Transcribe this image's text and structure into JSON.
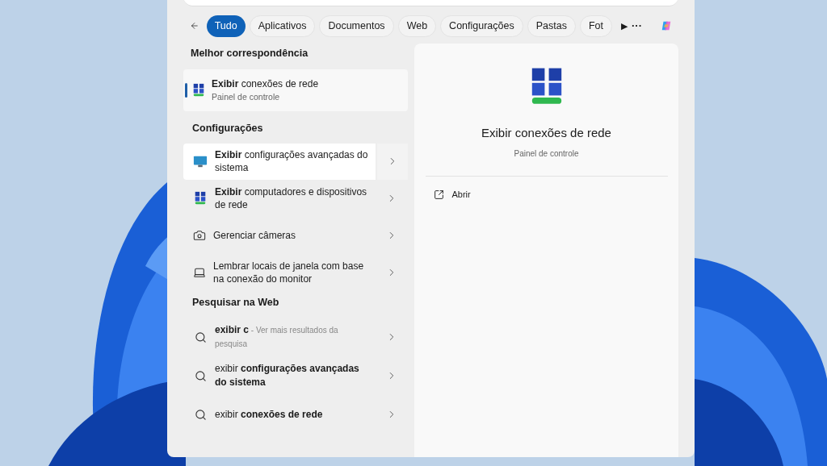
{
  "filters": [
    {
      "label": "Tudo",
      "selected": true
    },
    {
      "label": "Aplicativos",
      "selected": false
    },
    {
      "label": "Documentos",
      "selected": false
    },
    {
      "label": "Web",
      "selected": false
    },
    {
      "label": "Configurações",
      "selected": false
    },
    {
      "label": "Pastas",
      "selected": false
    },
    {
      "label": "Fot",
      "selected": false
    }
  ],
  "more_filters": "▶",
  "overflow": "···",
  "best_match": {
    "heading": "Melhor correspondência",
    "title": "**Exibir** conexões de rede",
    "subtitle": "Painel de controle",
    "selected": true
  },
  "settings": {
    "heading": "Configurações",
    "items": [
      {
        "kind": "monitor",
        "title": "**Exibir** configurações avançadas do sistema",
        "highlighted": true
      },
      {
        "kind": "network",
        "title": "**Exibir** computadores e dispositivos de rede",
        "highlighted": false
      },
      {
        "kind": "camera",
        "title": "Gerenciar câmeras",
        "highlighted": false
      },
      {
        "kind": "laptop",
        "title": "Lembrar locais de janela com base na conexão do monitor",
        "highlighted": false
      }
    ]
  },
  "web_search": {
    "heading": "Pesquisar na Web",
    "items": [
      {
        "query": "**exibir c**",
        "hint": " - Ver mais resultados da pesquisa"
      },
      {
        "query": "exibir **configurações avançadas do sistema**"
      },
      {
        "query": "exibir **conexões de rede**"
      }
    ]
  },
  "preview": {
    "title": "Exibir conexões de rede",
    "subtitle": "Painel de controle",
    "actions": [
      {
        "label": "Abrir"
      }
    ]
  }
}
